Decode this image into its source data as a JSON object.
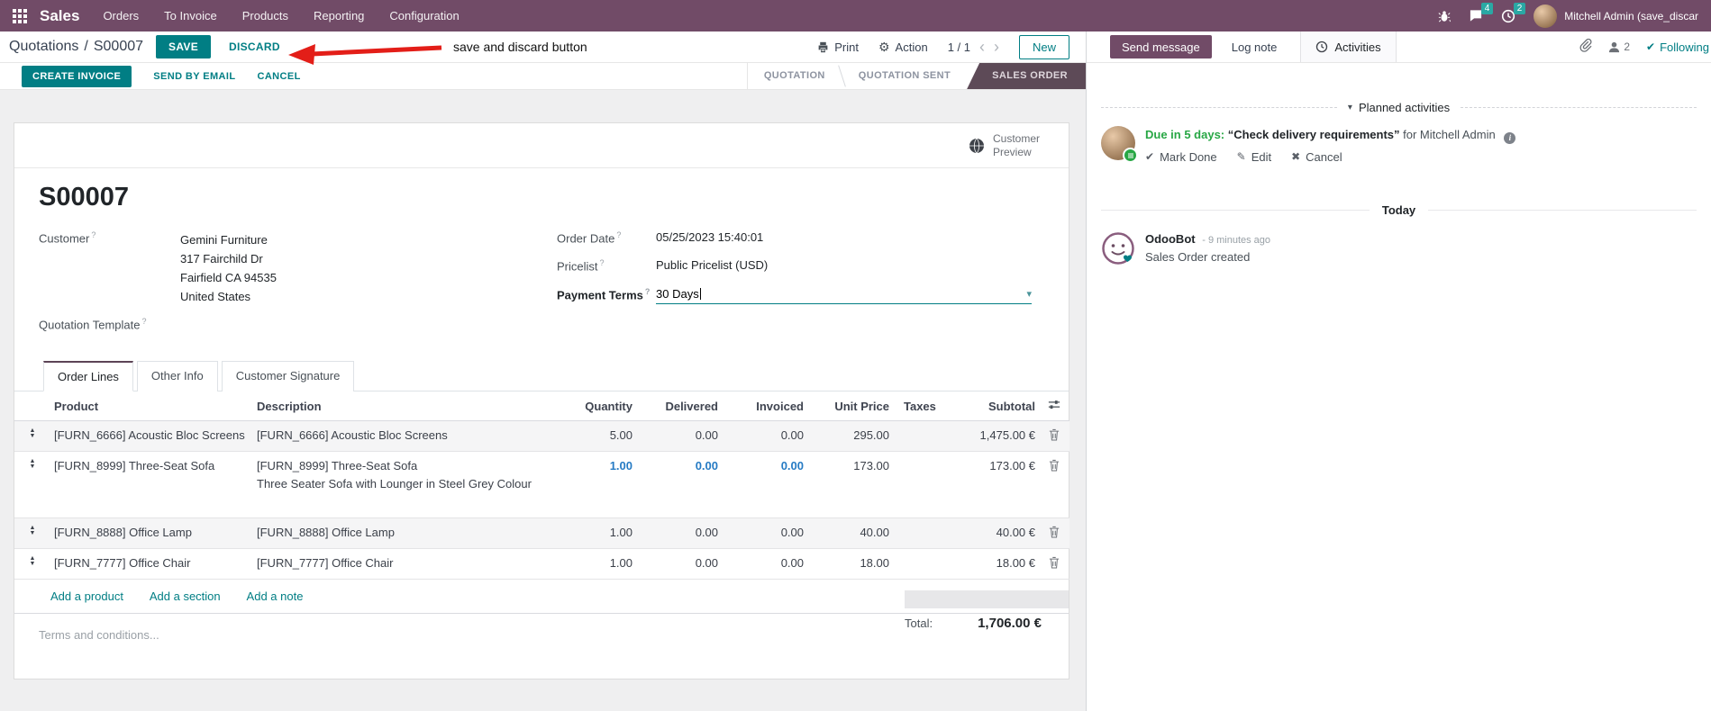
{
  "colors": {
    "brand": "#714B67",
    "primary": "#017E84",
    "active_stage_bg": "#5d4a57",
    "badge_teal": "#2aa8a4",
    "edited_blue": "#267bc4",
    "activity_green": "#28a745",
    "arrow_red": "#e31e18"
  },
  "icons": {
    "gear": "⚙",
    "caret_down": "▾",
    "chevron_left": "‹",
    "chevron_right": "›",
    "handle_up": "▲",
    "handle_down": "▼",
    "check": "✔",
    "pencil": "✎",
    "cross": "✖",
    "help": "?",
    "info": "i"
  },
  "nav": {
    "app_name": "Sales",
    "items": [
      "Orders",
      "To Invoice",
      "Products",
      "Reporting",
      "Configuration"
    ],
    "message_badge": "4",
    "activity_badge": "2",
    "user_name": "Mitchell Admin (save_discar"
  },
  "control": {
    "breadcrumb_parent": "Quotations",
    "breadcrumb_separator": "/",
    "breadcrumb_current": "S00007",
    "save_label": "SAVE",
    "discard_label": "DISCARD",
    "print_label": "Print",
    "action_label": "Action",
    "pager": "1 / 1",
    "new_label": "New"
  },
  "annotation": {
    "text": "save and discard button"
  },
  "statusbar": {
    "create_invoice": "CREATE INVOICE",
    "send_by_email": "SEND BY EMAIL",
    "cancel": "CANCEL",
    "stages": {
      "quotation": "QUOTATION",
      "quotation_sent": "QUOTATION SENT",
      "sales_order": "SALES ORDER"
    }
  },
  "sheet": {
    "customer_preview": "Customer Preview",
    "order_name": "S00007",
    "fields": {
      "customer_label": "Customer",
      "customer_name": "Gemini Furniture",
      "address_line1": "317 Fairchild Dr",
      "address_line2": "Fairfield CA 94535",
      "address_line3": "United States",
      "quotation_template_label": "Quotation Template",
      "order_date_label": "Order Date",
      "order_date_value": "05/25/2023 15:40:01",
      "pricelist_label": "Pricelist",
      "pricelist_value": "Public Pricelist (USD)",
      "payment_terms_label": "Payment Terms",
      "payment_terms_value": "30 Days"
    },
    "tabs": {
      "order_lines": "Order Lines",
      "other_info": "Other Info",
      "customer_signature": "Customer Signature"
    },
    "table": {
      "headers": {
        "product": "Product",
        "description": "Description",
        "quantity": "Quantity",
        "delivered": "Delivered",
        "invoiced": "Invoiced",
        "unit_price": "Unit Price",
        "taxes": "Taxes",
        "subtotal": "Subtotal"
      },
      "rows": [
        {
          "product": "[FURN_6666] Acoustic Bloc Screens",
          "description": "[FURN_6666] Acoustic Bloc Screens",
          "quantity": "5.00",
          "delivered": "0.00",
          "invoiced": "0.00",
          "unit_price": "295.00",
          "subtotal": "1,475.00 €"
        },
        {
          "product": "[FURN_8999] Three-Seat Sofa",
          "description": "[FURN_8999] Three-Seat Sofa",
          "description2": "Three Seater Sofa with Lounger in Steel Grey Colour",
          "quantity": "1.00",
          "delivered": "0.00",
          "invoiced": "0.00",
          "unit_price": "173.00",
          "subtotal": "173.00 €"
        },
        {
          "product": "[FURN_8888] Office Lamp",
          "description": "[FURN_8888] Office Lamp",
          "quantity": "1.00",
          "delivered": "0.00",
          "invoiced": "0.00",
          "unit_price": "40.00",
          "subtotal": "40.00 €"
        },
        {
          "product": "[FURN_7777] Office Chair",
          "description": "[FURN_7777] Office Chair",
          "quantity": "1.00",
          "delivered": "0.00",
          "invoiced": "0.00",
          "unit_price": "18.00",
          "subtotal": "18.00 €"
        }
      ],
      "add_product": "Add a product",
      "add_section": "Add a section",
      "add_note": "Add a note"
    },
    "terms_placeholder": "Terms and conditions...",
    "total_label": "Total:",
    "total_value": "1,706.00 €"
  },
  "chatter": {
    "send_message": "Send message",
    "log_note": "Log note",
    "activities_tab": "Activities",
    "followers_count": "2",
    "following_label": "Following",
    "planned_header": "Planned activities",
    "activity": {
      "due": "Due in 5 days:",
      "title": "“Check delivery requirements”",
      "assignee": "for Mitchell Admin",
      "mark_done": "Mark Done",
      "edit": "Edit",
      "cancel": "Cancel"
    },
    "today": "Today",
    "message": {
      "author": "OdooBot",
      "time": "- 9 minutes ago",
      "body": "Sales Order created"
    }
  }
}
